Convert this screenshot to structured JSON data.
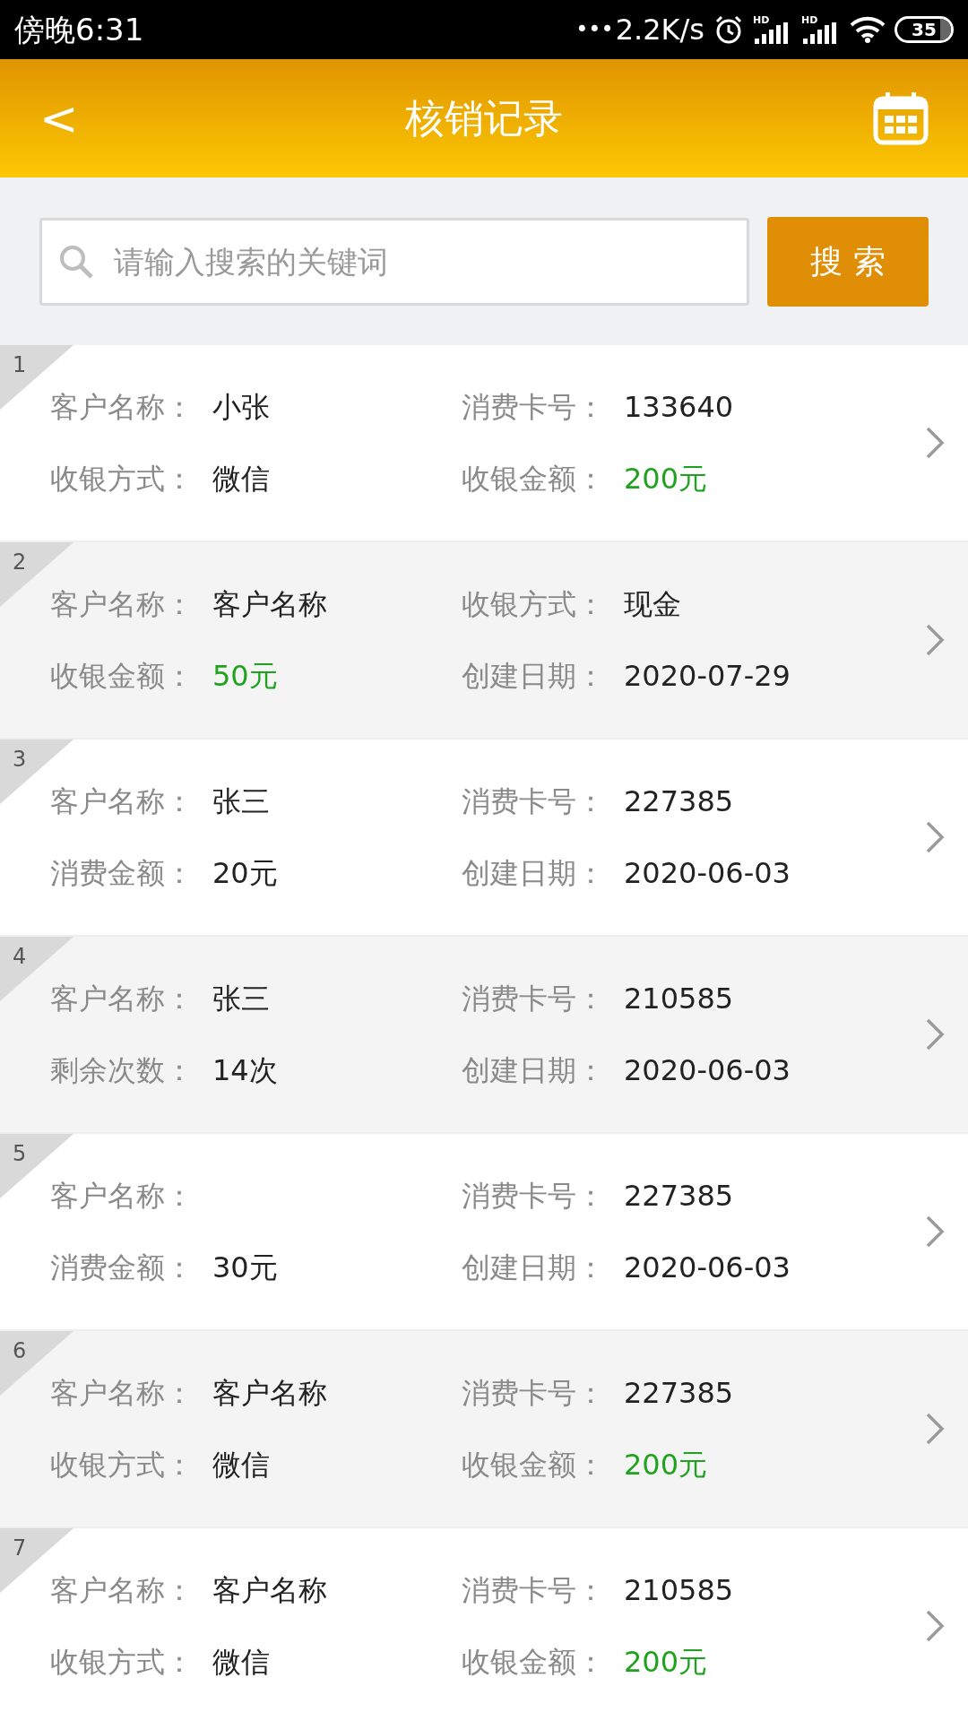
{
  "status_bar": {
    "time": "傍晚6:31",
    "dots": "•••",
    "speed": "2.2K/s",
    "sim_labels": [
      "HD",
      "HD"
    ],
    "battery": "35"
  },
  "header": {
    "back": "<",
    "title": "核销记录"
  },
  "search": {
    "placeholder": "请输入搜索的关键词",
    "button": "搜 索"
  },
  "records": [
    {
      "index": "1",
      "fields": [
        {
          "label": "客户名称：",
          "value": "小张",
          "highlight": false
        },
        {
          "label": "消费卡号：",
          "value": "133640",
          "highlight": false
        },
        {
          "label": "收银方式：",
          "value": "微信",
          "highlight": false
        },
        {
          "label": "收银金额：",
          "value": "200元",
          "highlight": true
        }
      ]
    },
    {
      "index": "2",
      "fields": [
        {
          "label": "客户名称：",
          "value": "客户名称",
          "highlight": false
        },
        {
          "label": "收银方式：",
          "value": "现金",
          "highlight": false
        },
        {
          "label": "收银金额：",
          "value": "50元",
          "highlight": true
        },
        {
          "label": "创建日期：",
          "value": "2020-07-29",
          "highlight": false
        }
      ]
    },
    {
      "index": "3",
      "fields": [
        {
          "label": "客户名称：",
          "value": "张三",
          "highlight": false
        },
        {
          "label": "消费卡号：",
          "value": "227385",
          "highlight": false
        },
        {
          "label": "消费金额：",
          "value": "20元",
          "highlight": false
        },
        {
          "label": "创建日期：",
          "value": "2020-06-03",
          "highlight": false
        }
      ]
    },
    {
      "index": "4",
      "fields": [
        {
          "label": "客户名称：",
          "value": "张三",
          "highlight": false
        },
        {
          "label": "消费卡号：",
          "value": "210585",
          "highlight": false
        },
        {
          "label": "剩余次数：",
          "value": "14次",
          "highlight": false
        },
        {
          "label": "创建日期：",
          "value": "2020-06-03",
          "highlight": false
        }
      ]
    },
    {
      "index": "5",
      "fields": [
        {
          "label": "客户名称："
        },
        {
          "label": "消费卡号：",
          "value": "227385",
          "highlight": false
        },
        {
          "label": "消费金额：",
          "value": "30元",
          "highlight": false
        },
        {
          "label": "创建日期：",
          "value": "2020-06-03",
          "highlight": false
        }
      ]
    },
    {
      "index": "6",
      "fields": [
        {
          "label": "客户名称：",
          "value": "客户名称",
          "highlight": false
        },
        {
          "label": "消费卡号：",
          "value": "227385",
          "highlight": false
        },
        {
          "label": "收银方式：",
          "value": "微信",
          "highlight": false
        },
        {
          "label": "收银金额：",
          "value": "200元",
          "highlight": true
        }
      ]
    },
    {
      "index": "7",
      "fields": [
        {
          "label": "客户名称：",
          "value": "客户名称",
          "highlight": false
        },
        {
          "label": "消费卡号：",
          "value": "210585",
          "highlight": false
        },
        {
          "label": "收银方式：",
          "value": "微信",
          "highlight": false
        },
        {
          "label": "收银金额：",
          "value": "200元",
          "highlight": true
        }
      ]
    }
  ]
}
